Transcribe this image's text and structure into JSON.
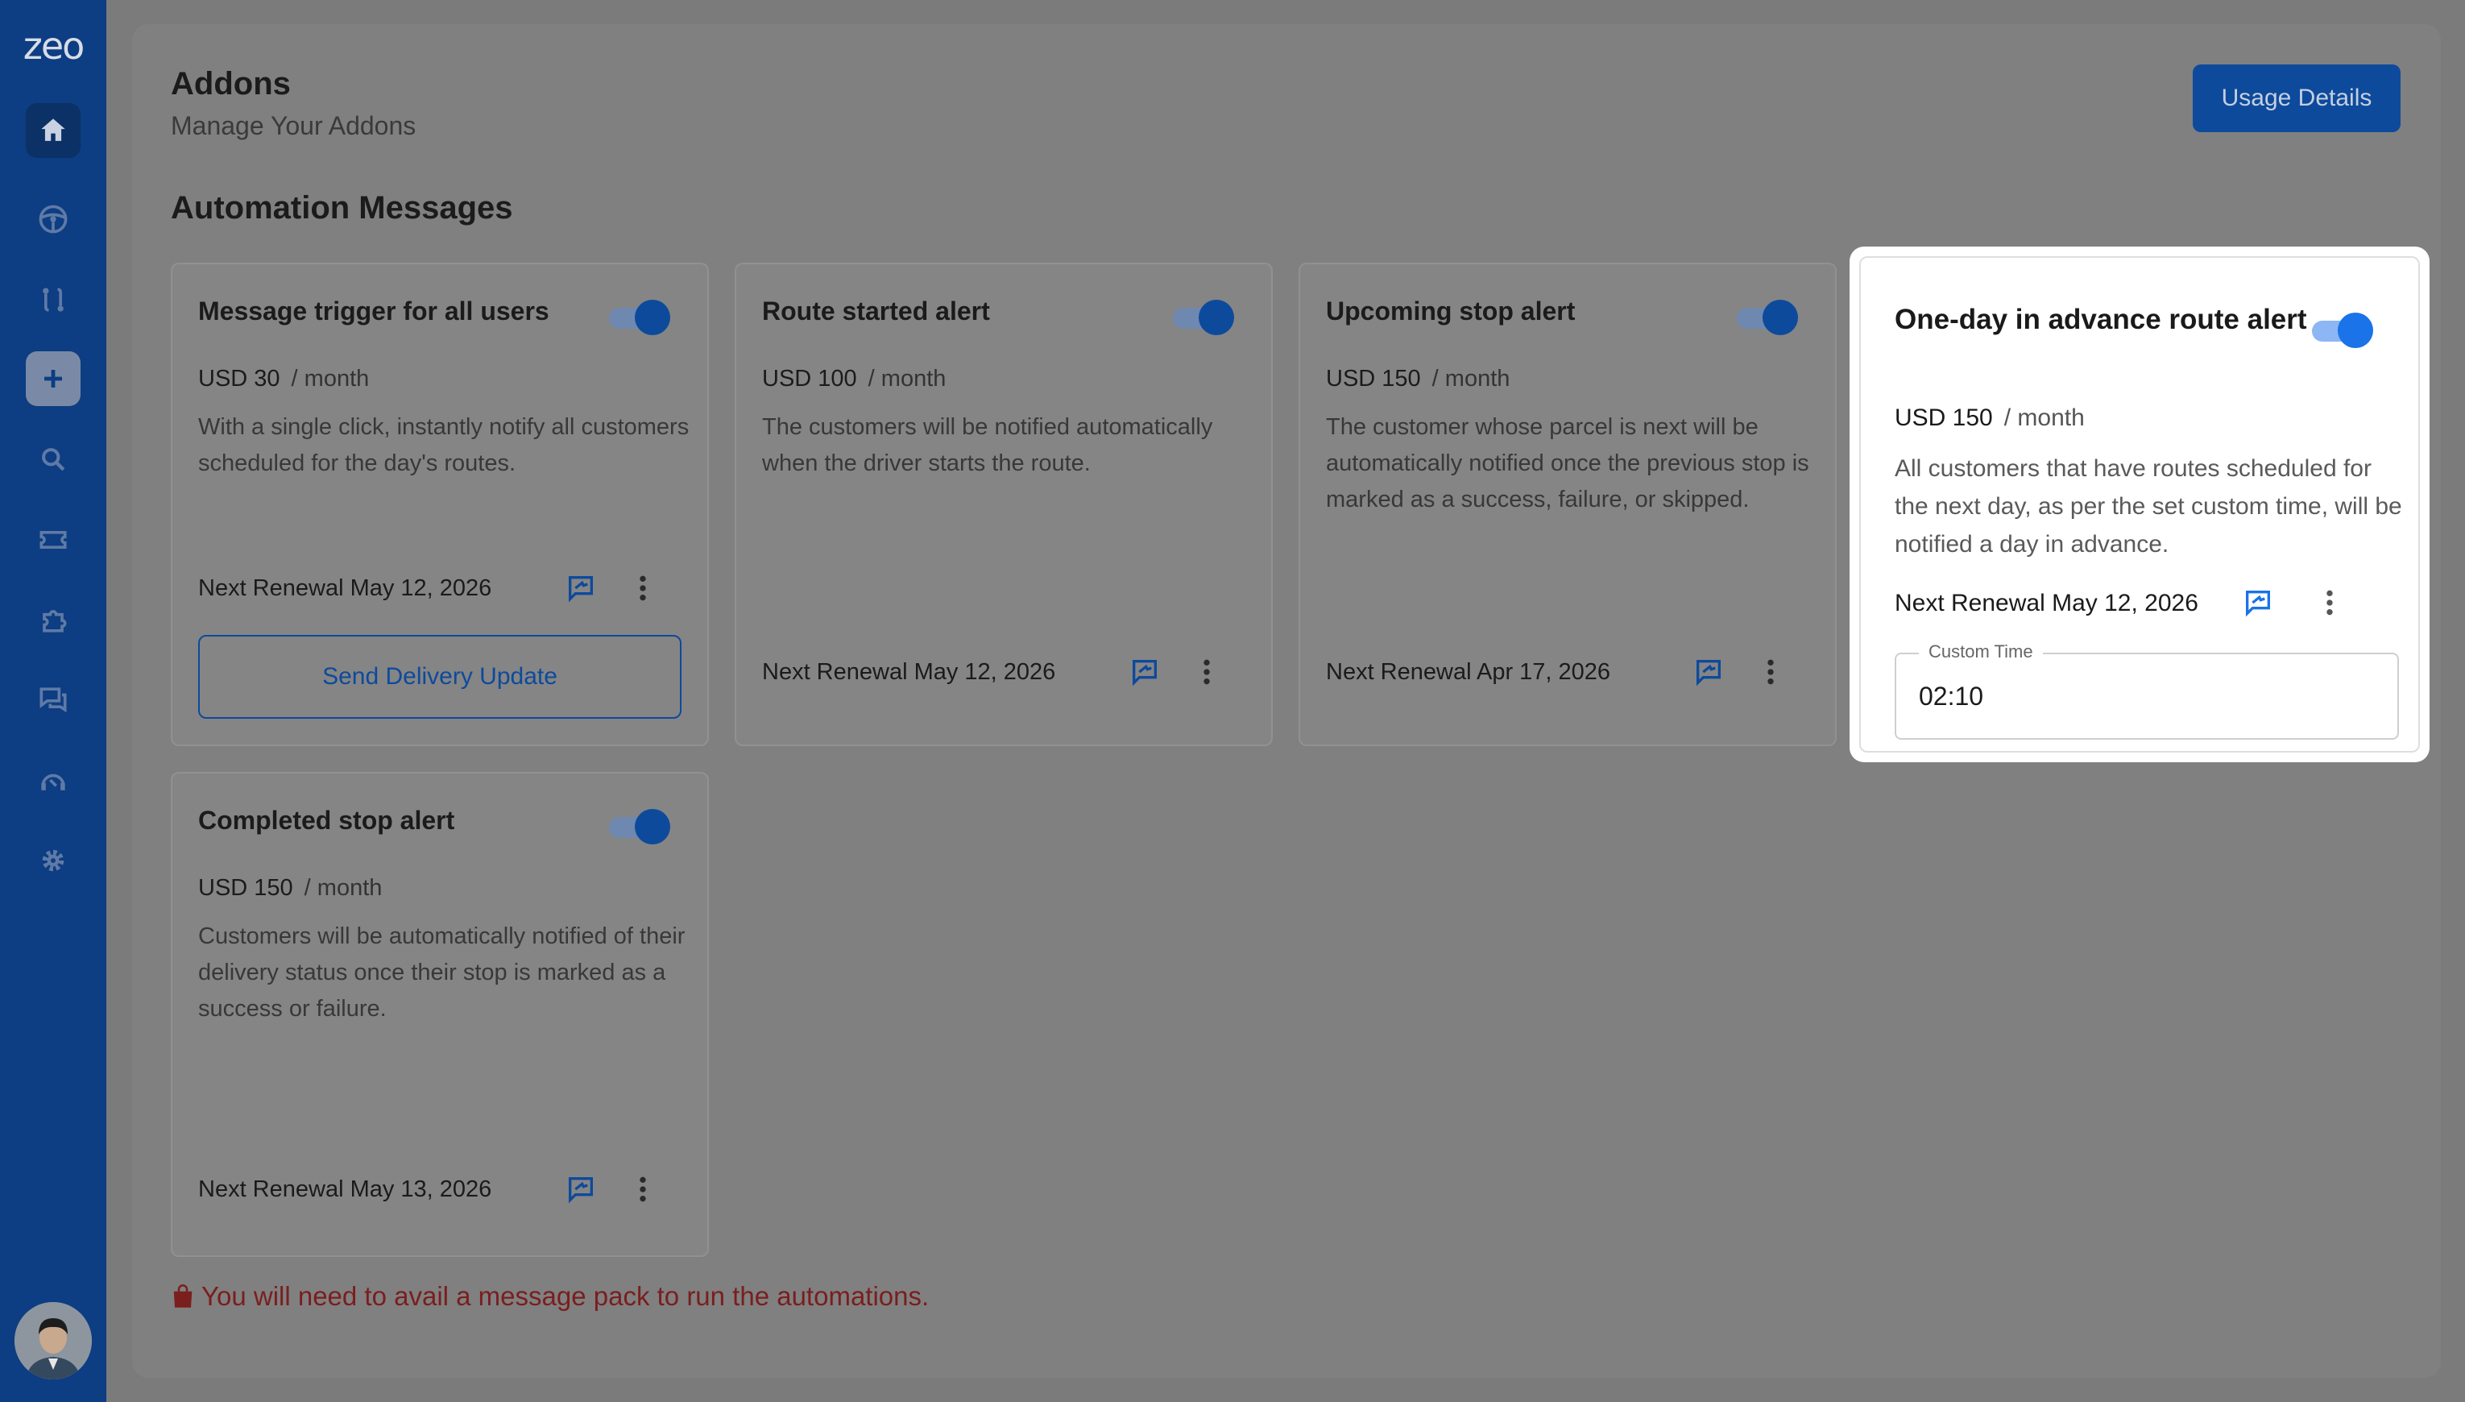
{
  "sidebar": {
    "logo": "zeo",
    "items": [
      {
        "icon": "home-icon",
        "active": true
      },
      {
        "icon": "steering-wheel-icon"
      },
      {
        "icon": "routes-icon"
      },
      {
        "icon": "plus-icon"
      },
      {
        "icon": "search-icon"
      },
      {
        "icon": "ticket-icon"
      },
      {
        "icon": "puzzle-icon"
      },
      {
        "icon": "chat-icon"
      },
      {
        "icon": "support-icon"
      },
      {
        "icon": "gear-icon"
      }
    ]
  },
  "header": {
    "title": "Addons",
    "subtitle": "Manage Your Addons",
    "usage_button": "Usage Details"
  },
  "section_title": "Automation Messages",
  "cards": [
    {
      "title": "Message trigger for all users",
      "price": "USD 30",
      "per": "/ month",
      "description": "With a single click, instantly notify all customers scheduled for the day's routes.",
      "renewal": "Next Renewal May 12, 2026",
      "enabled": true,
      "action_button": "Send Delivery Update"
    },
    {
      "title": "Route started alert",
      "price": "USD 100",
      "per": "/ month",
      "description": "The customers will be notified automatically when the driver starts the route.",
      "renewal": "Next Renewal May 12, 2026",
      "enabled": true
    },
    {
      "title": "Upcoming stop alert",
      "price": "USD 150",
      "per": "/ month",
      "description": "The customer whose parcel is next will be automatically notified once the previous stop is marked as a success, failure, or skipped.",
      "renewal": "Next Renewal Apr 17, 2026",
      "enabled": true
    },
    {
      "title": "One-day in advance route alert",
      "price": "USD 150",
      "per": "/ month",
      "description": "All customers that have routes scheduled for the next day, as per the set custom time, will be notified a day in advance.",
      "renewal": "Next Renewal May 12, 2026",
      "enabled": true,
      "custom_time_label": "Custom Time",
      "custom_time_value": "02:10"
    },
    {
      "title": "Completed stop alert",
      "price": "USD 150",
      "per": "/ month",
      "description": "Customers will be automatically notified of their delivery status once their stop is marked as a success or failure.",
      "renewal": "Next Renewal May 13, 2026",
      "enabled": true
    }
  ],
  "warning": "You will need to avail a message pack to run the automations.",
  "colors": {
    "sidebar": "#0d3d82",
    "primary": "#0d4a9c",
    "toggle_active": "#1a73e8",
    "warning": "#7a1e1e"
  }
}
